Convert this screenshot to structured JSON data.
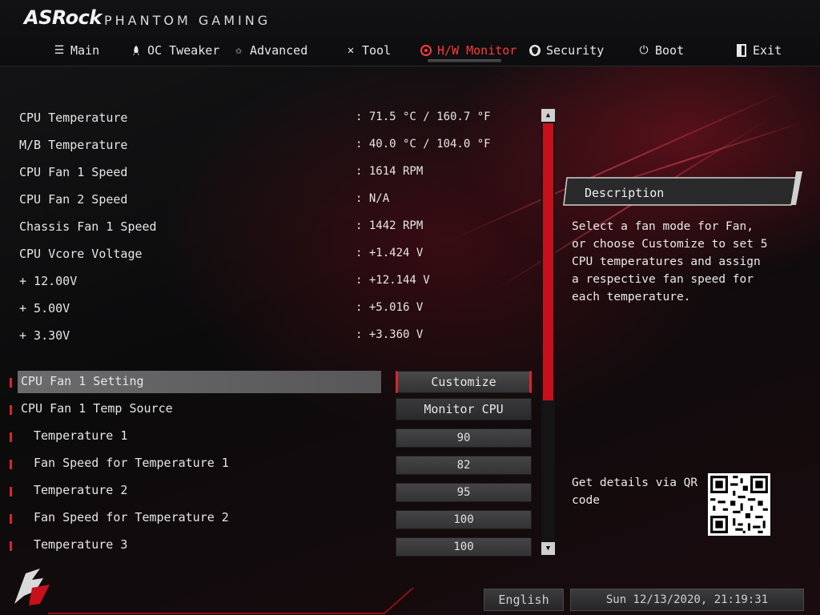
{
  "brand": {
    "logo": "ASRock",
    "subtitle": "PHANTOM GAMING"
  },
  "nav": {
    "items": [
      {
        "id": "main",
        "label": "Main",
        "icon": "list-icon"
      },
      {
        "id": "oc",
        "label": "OC Tweaker",
        "icon": "rocket-icon"
      },
      {
        "id": "advanced",
        "label": "Advanced",
        "icon": "star-icon"
      },
      {
        "id": "tool",
        "label": "Tool",
        "icon": "tools-icon"
      },
      {
        "id": "hw",
        "label": "H/W Monitor",
        "icon": "monitor-icon",
        "active": true
      },
      {
        "id": "security",
        "label": "Security",
        "icon": "shield-icon"
      },
      {
        "id": "boot",
        "label": "Boot",
        "icon": "power-icon"
      },
      {
        "id": "exit",
        "label": "Exit",
        "icon": "exit-icon"
      }
    ]
  },
  "readings": [
    {
      "label": "CPU Temperature",
      "value": ": 71.5 °C / 160.7 °F"
    },
    {
      "label": "M/B Temperature",
      "value": ": 40.0 °C / 104.0 °F"
    },
    {
      "label": "CPU Fan 1 Speed",
      "value": ": 1614 RPM"
    },
    {
      "label": "CPU Fan 2 Speed",
      "value": ": N/A"
    },
    {
      "label": "Chassis Fan 1 Speed",
      "value": ": 1442 RPM"
    },
    {
      "label": "CPU Vcore Voltage",
      "value": ": +1.424 V"
    },
    {
      "label": "+ 12.00V",
      "value": ": +12.144 V"
    },
    {
      "label": "+ 5.00V",
      "value": ": +5.016 V"
    },
    {
      "label": "+ 3.30V",
      "value": ": +3.360 V"
    }
  ],
  "settings": [
    {
      "label": "CPU Fan 1 Setting",
      "value": "Customize",
      "kind": "option",
      "selected": true
    },
    {
      "label": "CPU Fan 1 Temp Source",
      "value": "Monitor CPU",
      "kind": "option"
    },
    {
      "label": "Temperature 1",
      "value": "90",
      "kind": "number"
    },
    {
      "label": "Fan Speed for Temperature 1",
      "value": "82",
      "kind": "number"
    },
    {
      "label": "Temperature 2",
      "value": "95",
      "kind": "number"
    },
    {
      "label": "Fan Speed for Temperature 2",
      "value": "100",
      "kind": "number"
    },
    {
      "label": "Temperature 3",
      "value": "100",
      "kind": "number"
    }
  ],
  "description": {
    "title": "Description",
    "text": "Select a fan mode for Fan, or choose Customize to set 5 CPU temperatures and assign a respective fan speed for each temperature."
  },
  "qr": {
    "label": "Get details via QR code"
  },
  "footer": {
    "language": "English",
    "datetime": "Sun 12/13/2020, 21:19:31"
  },
  "colors": {
    "accent": "#d8262e",
    "active_tab": "#ff3a3a",
    "scroll_thumb": "#c8101c"
  }
}
